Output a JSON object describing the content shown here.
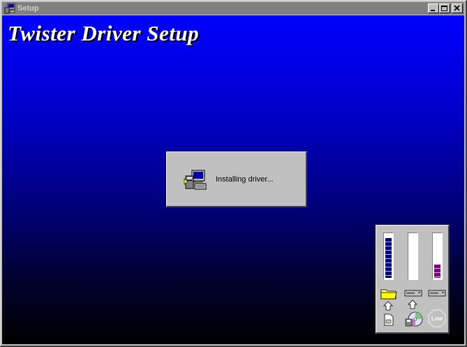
{
  "window": {
    "title": "Setup",
    "icons": {
      "app": "setup-app-icon",
      "minimize": "minimize-icon",
      "maximize": "maximize-icon",
      "close": "close-icon"
    }
  },
  "banner": {
    "title": "Twister Driver Setup",
    "color": "#ffffff"
  },
  "background": {
    "gradient_top": "#0000ff",
    "gradient_bottom": "#000000"
  },
  "progress_dialog": {
    "icon": "computer-install-icon",
    "message": "Installing driver..."
  },
  "meters": {
    "items": [
      {
        "name": "source",
        "fill_fraction": 0.92,
        "color": "#000080",
        "icons": [
          "folder-icon",
          "arrow-up-icon",
          "document-icon"
        ]
      },
      {
        "name": "destination",
        "fill_fraction": 0.0,
        "color": "#ffffff",
        "icons": [
          "drive-icon",
          "arrow-up-icon",
          "cd-disk-icon"
        ]
      },
      {
        "name": "disk-space",
        "fill_fraction": 0.35,
        "color": "#800080",
        "icons": [
          "drive-icon",
          "low-octagon-icon"
        ]
      }
    ],
    "low_label": "Low"
  }
}
